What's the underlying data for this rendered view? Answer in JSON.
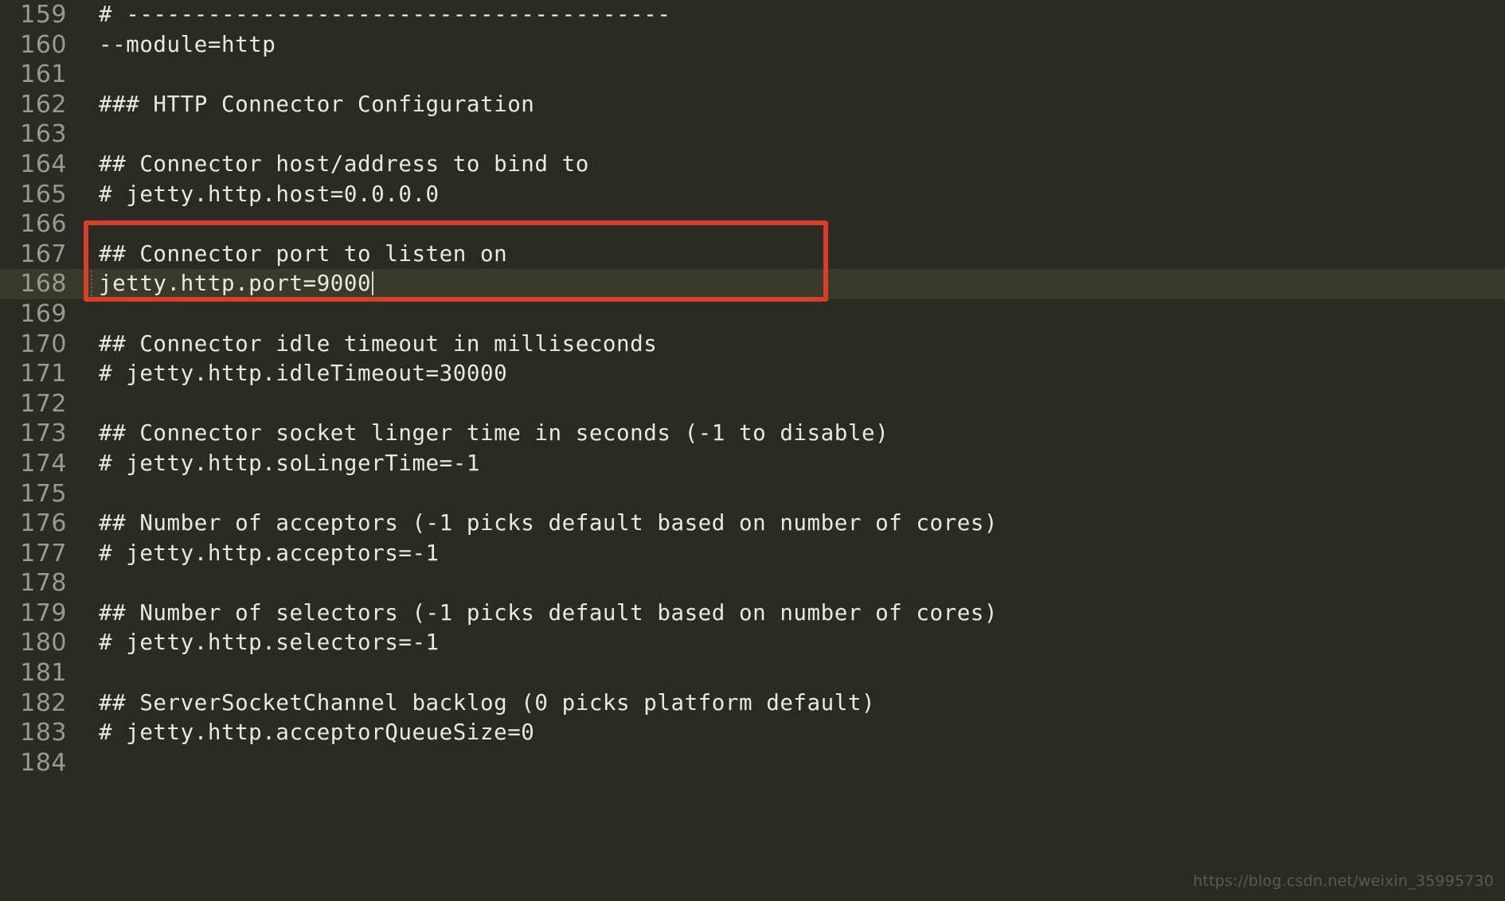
{
  "editor": {
    "theme_background": "#2b2b26",
    "text_color": "#e9e9e2",
    "gutter_color": "#9a9a95",
    "current_line_background": "#383a2c",
    "annotation_color": "#d93f28",
    "file_kind": "jetty properties configuration",
    "current_line_number": 168,
    "lines": [
      {
        "num": "159",
        "text": "# ----------------------------------------"
      },
      {
        "num": "160",
        "text": "--module=http"
      },
      {
        "num": "161",
        "text": ""
      },
      {
        "num": "162",
        "text": "### HTTP Connector Configuration"
      },
      {
        "num": "163",
        "text": ""
      },
      {
        "num": "164",
        "text": "## Connector host/address to bind to"
      },
      {
        "num": "165",
        "text": "# jetty.http.host=0.0.0.0"
      },
      {
        "num": "166",
        "text": ""
      },
      {
        "num": "167",
        "text": "## Connector port to listen on"
      },
      {
        "num": "168",
        "text": "jetty.http.port=9000"
      },
      {
        "num": "169",
        "text": ""
      },
      {
        "num": "170",
        "text": "## Connector idle timeout in milliseconds"
      },
      {
        "num": "171",
        "text": "# jetty.http.idleTimeout=30000"
      },
      {
        "num": "172",
        "text": ""
      },
      {
        "num": "173",
        "text": "## Connector socket linger time in seconds (-1 to disable)"
      },
      {
        "num": "174",
        "text": "# jetty.http.soLingerTime=-1"
      },
      {
        "num": "175",
        "text": ""
      },
      {
        "num": "176",
        "text": "## Number of acceptors (-1 picks default based on number of cores)"
      },
      {
        "num": "177",
        "text": "# jetty.http.acceptors=-1"
      },
      {
        "num": "178",
        "text": ""
      },
      {
        "num": "179",
        "text": "## Number of selectors (-1 picks default based on number of cores)"
      },
      {
        "num": "180",
        "text": "# jetty.http.selectors=-1"
      },
      {
        "num": "181",
        "text": ""
      },
      {
        "num": "182",
        "text": "## ServerSocketChannel backlog (0 picks platform default)"
      },
      {
        "num": "183",
        "text": "# jetty.http.acceptorQueueSize=0"
      },
      {
        "num": "184",
        "text": ""
      }
    ]
  },
  "annotation": {
    "highlighted_lines": [
      "167",
      "168"
    ],
    "highlighted_text": "## Connector port to listen on\njetty.http.port=9000"
  },
  "watermark": {
    "text": "https://blog.csdn.net/weixin_35995730"
  }
}
